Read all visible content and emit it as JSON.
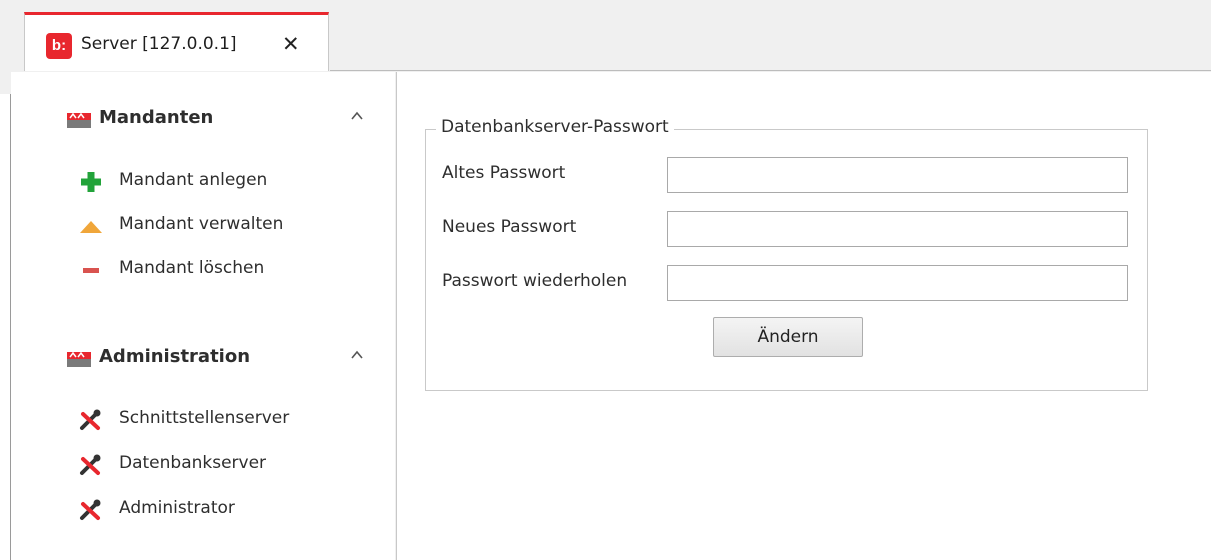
{
  "tab": {
    "title": "Server [127.0.0.1]",
    "logo_text": "b:",
    "close_glyph": "✕"
  },
  "sidebar": {
    "groups": [
      {
        "title": "Mandanten",
        "icon": "folder-group-icon",
        "items": [
          {
            "label": "Mandant anlegen",
            "icon": "plus-icon"
          },
          {
            "label": "Mandant verwalten",
            "icon": "triangle-icon"
          },
          {
            "label": "Mandant löschen",
            "icon": "minus-icon"
          }
        ]
      },
      {
        "title": "Administration",
        "icon": "folder-group-icon",
        "items": [
          {
            "label": "Schnittstellenserver",
            "icon": "tools-icon"
          },
          {
            "label": "Datenbankserver",
            "icon": "tools-icon"
          },
          {
            "label": "Administrator",
            "icon": "tools-icon"
          }
        ]
      }
    ]
  },
  "form": {
    "legend": "Datenbankserver-Passwort",
    "fields": [
      {
        "label": "Altes Passwort",
        "value": ""
      },
      {
        "label": "Neues Passwort",
        "value": ""
      },
      {
        "label": "Passwort wiederholen",
        "value": ""
      }
    ],
    "submit_label": "Ändern"
  },
  "colors": {
    "accent": "#e8272e",
    "plus": "#22a33a",
    "triangle": "#f0a63a",
    "minus": "#d9534f"
  }
}
